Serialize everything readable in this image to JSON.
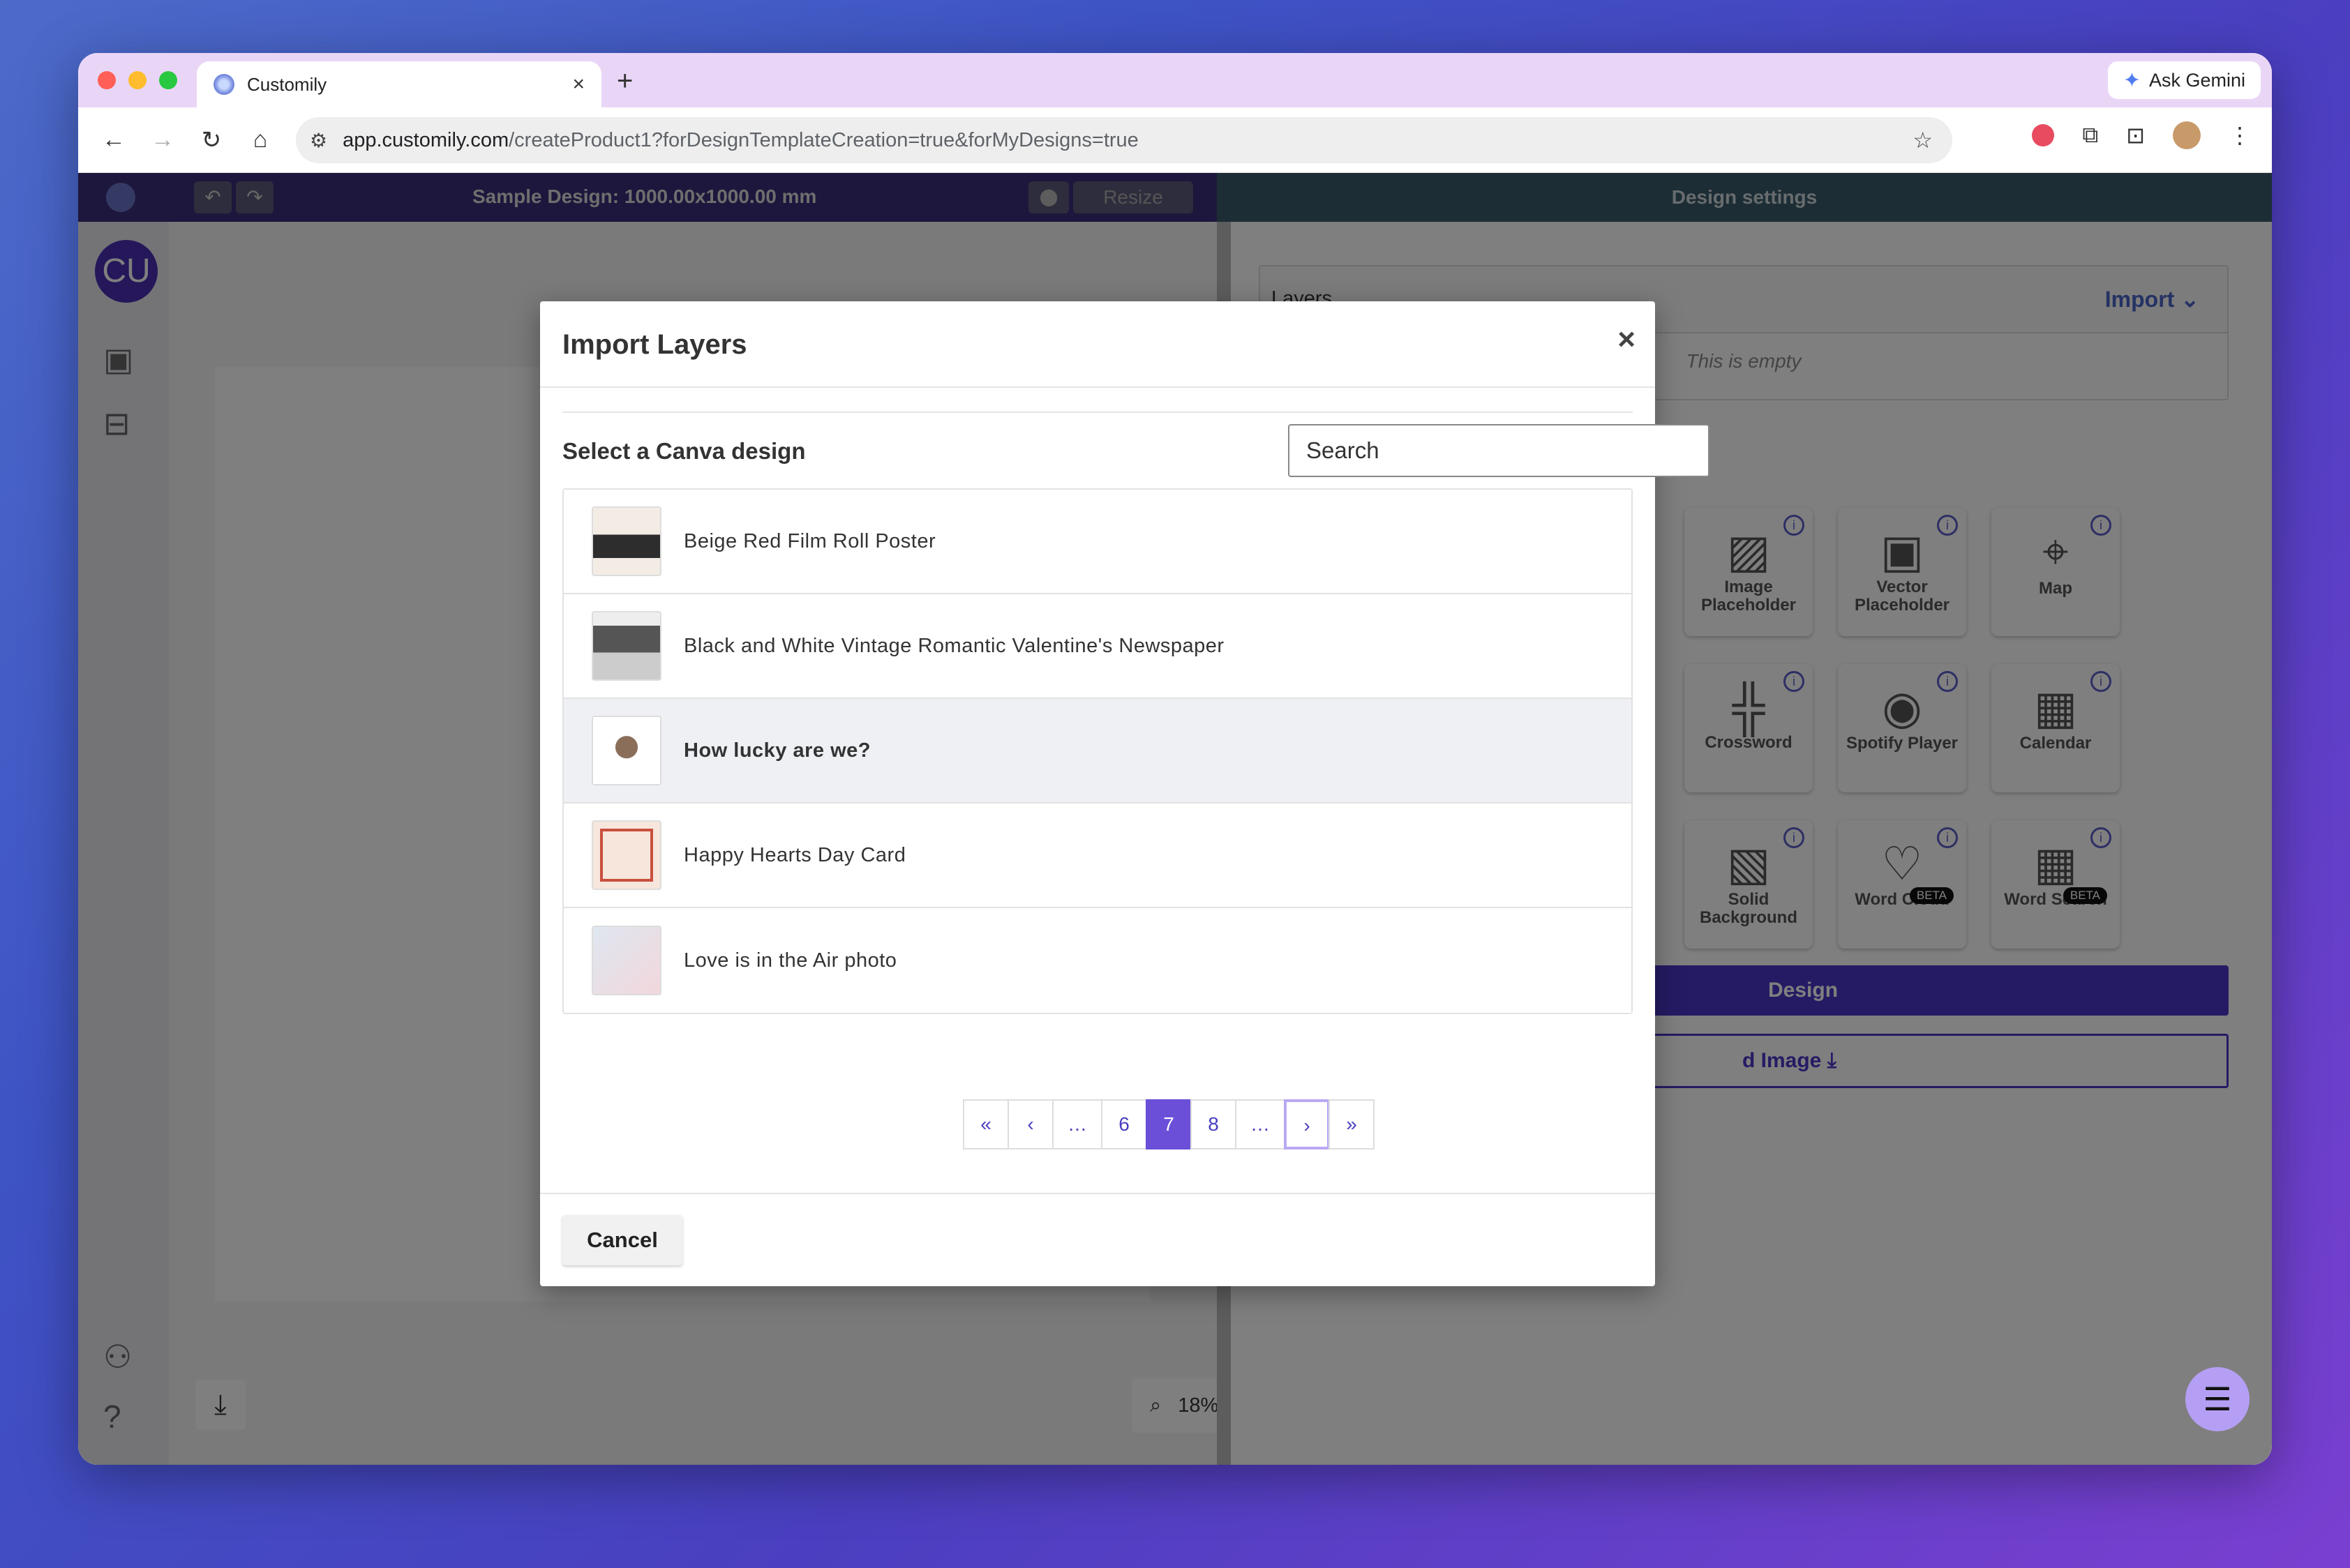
{
  "browser": {
    "tab_title": "Customily",
    "tab_close": "×",
    "new_tab": "+",
    "ask_gemini": "Ask Gemini",
    "url_host": "app.customily.com",
    "url_path": "/createProduct1?forDesignTemplateCreation=true&forMyDesigns=true"
  },
  "app": {
    "design_title": "Sample Design: 1000.00x1000.00 mm",
    "resize_label": "Resize",
    "settings_title": "Design settings",
    "avatar_initials": "CU",
    "zoom_level": "18%",
    "layers_label": "Layers",
    "import_label": "Import",
    "empty_label": "This is empty",
    "tiles": [
      {
        "label": "Image Placeholder"
      },
      {
        "label": "Vector Placeholder"
      },
      {
        "label": "Map"
      },
      {
        "label": "Crossword"
      },
      {
        "label": "Spotify Player"
      },
      {
        "label": "Calendar"
      },
      {
        "label": "Solid Background"
      },
      {
        "label": "Word Cloud",
        "badge": "BETA"
      },
      {
        "label": "Word Search",
        "badge": "BETA"
      }
    ],
    "design_button": "Design",
    "image_button": "d Image"
  },
  "modal": {
    "title": "Import Layers",
    "close": "×",
    "select_label": "Select a Canva design",
    "search_placeholder": "Search",
    "items": [
      {
        "label": "Beige Red Film Roll Poster"
      },
      {
        "label": "Black and White Vintage Romantic Valentine's Newspaper"
      },
      {
        "label": "How lucky are we?"
      },
      {
        "label": "Happy Hearts Day Card"
      },
      {
        "label": "Love is in the Air photo"
      }
    ],
    "pagination": [
      "«",
      "‹",
      "…",
      "6",
      "7",
      "8",
      "…",
      "›",
      "»"
    ],
    "current_page": "7",
    "cancel_label": "Cancel"
  }
}
